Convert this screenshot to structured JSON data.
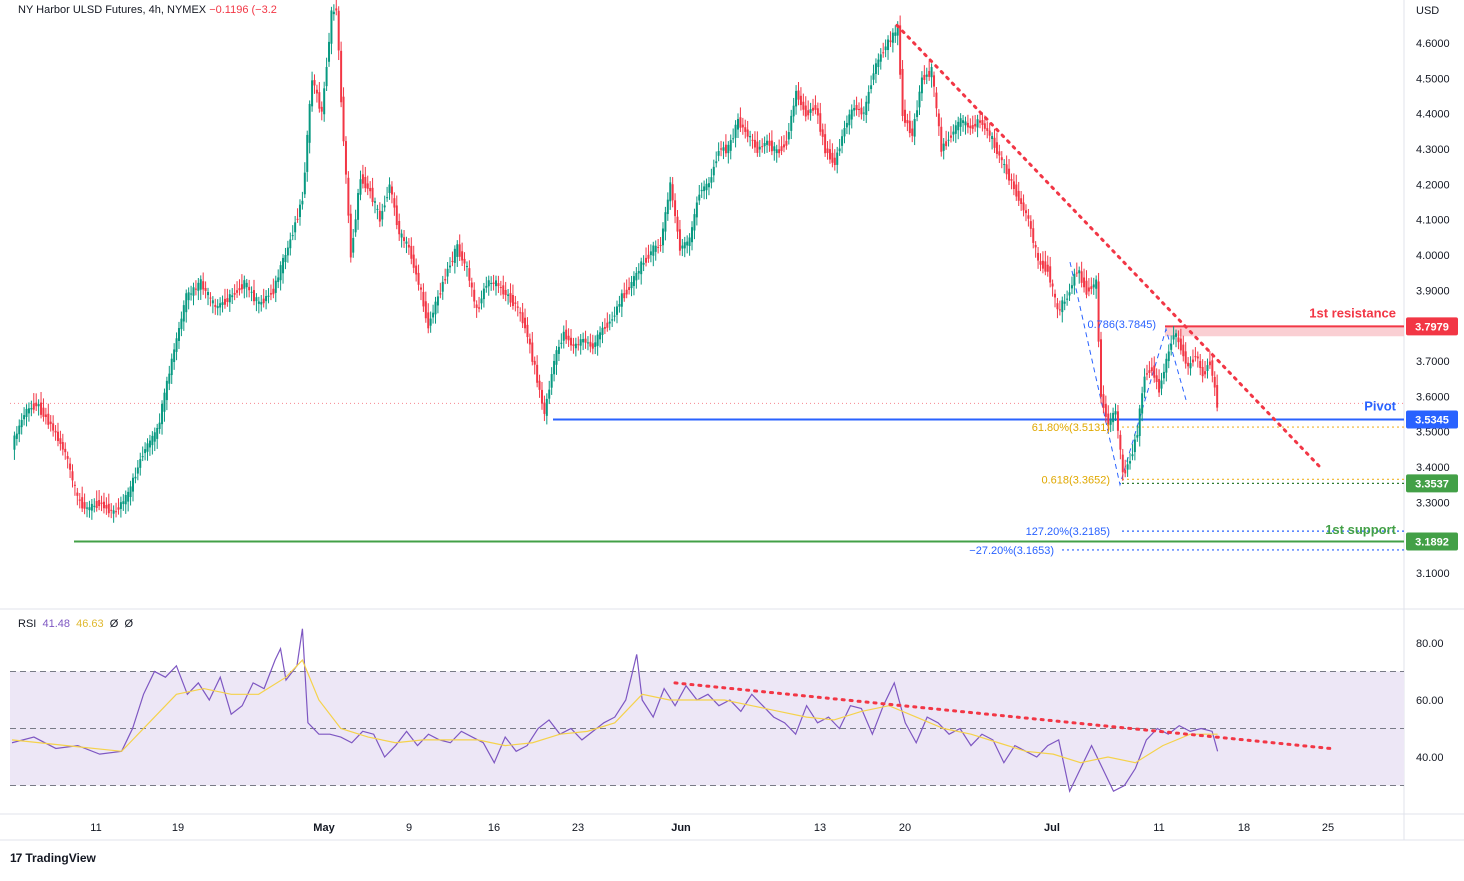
{
  "header": {
    "symbol": "NY Harbor ULSD Futures",
    "interval": "4h",
    "exchange": "NYMEX",
    "change": "−0.1196 (−3.2"
  },
  "rsi_header": {
    "label": "RSI",
    "value1": "41.48",
    "value2": "46.63",
    "z1": "Ø",
    "z2": "Ø"
  },
  "branding": {
    "logo_text": "TradingView",
    "logo_mark": "17"
  },
  "colors": {
    "up": "#089981",
    "down": "#f23645",
    "resistance": "#f23645",
    "pivot": "#2962ff",
    "support": "#43a047",
    "fib": "#f0b429",
    "fib_blue": "#2962ff",
    "rsi": "#7e57c2",
    "rsi_ma": "#f5d24b",
    "rsi_band": "#ede7f6",
    "trendline": "#f23645"
  },
  "chart_data": [
    {
      "type": "candlestick",
      "title": "NY Harbor ULSD Futures, 4h, NYMEX",
      "currency_label": "USD",
      "ylim": [
        3.04,
        4.72
      ],
      "y_ticks": [
        "4.6000",
        "4.5000",
        "4.4000",
        "4.3000",
        "4.2000",
        "4.1000",
        "4.0000",
        "3.9000",
        "3.7000",
        "3.6000",
        "3.5000",
        "3.4000",
        "3.3000",
        "3.1000"
      ],
      "x_ticks": [
        "11",
        "19",
        "May",
        "9",
        "16",
        "23",
        "Jun",
        "13",
        "20",
        "Jul",
        "11",
        "18",
        "25"
      ],
      "x_tick_bold": [
        "May",
        "Jun",
        "Jul"
      ],
      "close_series": [
        {
          "t": 0,
          "c": 3.46
        },
        {
          "t": 5,
          "c": 3.55
        },
        {
          "t": 10,
          "c": 3.58
        },
        {
          "t": 16,
          "c": 3.52
        },
        {
          "t": 22,
          "c": 3.44
        },
        {
          "t": 27,
          "c": 3.31
        },
        {
          "t": 31,
          "c": 3.28
        },
        {
          "t": 36,
          "c": 3.3
        },
        {
          "t": 42,
          "c": 3.27
        },
        {
          "t": 48,
          "c": 3.32
        },
        {
          "t": 54,
          "c": 3.44
        },
        {
          "t": 60,
          "c": 3.5
        },
        {
          "t": 66,
          "c": 3.7
        },
        {
          "t": 72,
          "c": 3.88
        },
        {
          "t": 78,
          "c": 3.92
        },
        {
          "t": 84,
          "c": 3.85
        },
        {
          "t": 90,
          "c": 3.88
        },
        {
          "t": 96,
          "c": 3.92
        },
        {
          "t": 102,
          "c": 3.86
        },
        {
          "t": 108,
          "c": 3.9
        },
        {
          "t": 114,
          "c": 4.02
        },
        {
          "t": 120,
          "c": 4.16
        },
        {
          "t": 124,
          "c": 4.5
        },
        {
          "t": 128,
          "c": 4.4
        },
        {
          "t": 132,
          "c": 4.68
        },
        {
          "t": 134,
          "c": 4.7
        },
        {
          "t": 136,
          "c": 4.44
        },
        {
          "t": 140,
          "c": 4.0
        },
        {
          "t": 144,
          "c": 4.22
        },
        {
          "t": 148,
          "c": 4.18
        },
        {
          "t": 152,
          "c": 4.1
        },
        {
          "t": 156,
          "c": 4.2
        },
        {
          "t": 160,
          "c": 4.06
        },
        {
          "t": 164,
          "c": 4.02
        },
        {
          "t": 168,
          "c": 3.92
        },
        {
          "t": 172,
          "c": 3.8
        },
        {
          "t": 176,
          "c": 3.88
        },
        {
          "t": 180,
          "c": 3.96
        },
        {
          "t": 184,
          "c": 4.02
        },
        {
          "t": 188,
          "c": 3.96
        },
        {
          "t": 192,
          "c": 3.84
        },
        {
          "t": 196,
          "c": 3.92
        },
        {
          "t": 200,
          "c": 3.92
        },
        {
          "t": 204,
          "c": 3.89
        },
        {
          "t": 208,
          "c": 3.86
        },
        {
          "t": 212,
          "c": 3.8
        },
        {
          "t": 216,
          "c": 3.68
        },
        {
          "t": 220,
          "c": 3.55
        },
        {
          "t": 224,
          "c": 3.7
        },
        {
          "t": 228,
          "c": 3.78
        },
        {
          "t": 232,
          "c": 3.74
        },
        {
          "t": 236,
          "c": 3.76
        },
        {
          "t": 240,
          "c": 3.74
        },
        {
          "t": 244,
          "c": 3.79
        },
        {
          "t": 248,
          "c": 3.82
        },
        {
          "t": 252,
          "c": 3.88
        },
        {
          "t": 256,
          "c": 3.92
        },
        {
          "t": 260,
          "c": 3.97
        },
        {
          "t": 264,
          "c": 4.01
        },
        {
          "t": 268,
          "c": 4.03
        },
        {
          "t": 272,
          "c": 4.2
        },
        {
          "t": 276,
          "c": 4.02
        },
        {
          "t": 280,
          "c": 4.04
        },
        {
          "t": 284,
          "c": 4.18
        },
        {
          "t": 288,
          "c": 4.2
        },
        {
          "t": 292,
          "c": 4.3
        },
        {
          "t": 296,
          "c": 4.3
        },
        {
          "t": 300,
          "c": 4.38
        },
        {
          "t": 304,
          "c": 4.34
        },
        {
          "t": 308,
          "c": 4.3
        },
        {
          "t": 312,
          "c": 4.32
        },
        {
          "t": 316,
          "c": 4.29
        },
        {
          "t": 320,
          "c": 4.32
        },
        {
          "t": 324,
          "c": 4.46
        },
        {
          "t": 328,
          "c": 4.4
        },
        {
          "t": 332,
          "c": 4.42
        },
        {
          "t": 336,
          "c": 4.3
        },
        {
          "t": 340,
          "c": 4.26
        },
        {
          "t": 344,
          "c": 4.36
        },
        {
          "t": 348,
          "c": 4.42
        },
        {
          "t": 352,
          "c": 4.4
        },
        {
          "t": 356,
          "c": 4.52
        },
        {
          "t": 360,
          "c": 4.58
        },
        {
          "t": 364,
          "c": 4.62
        },
        {
          "t": 366,
          "c": 4.64
        },
        {
          "t": 368,
          "c": 4.4
        },
        {
          "t": 372,
          "c": 4.34
        },
        {
          "t": 376,
          "c": 4.5
        },
        {
          "t": 380,
          "c": 4.52
        },
        {
          "t": 384,
          "c": 4.3
        },
        {
          "t": 388,
          "c": 4.34
        },
        {
          "t": 392,
          "c": 4.38
        },
        {
          "t": 396,
          "c": 4.36
        },
        {
          "t": 400,
          "c": 4.38
        },
        {
          "t": 404,
          "c": 4.34
        },
        {
          "t": 408,
          "c": 4.28
        },
        {
          "t": 412,
          "c": 4.22
        },
        {
          "t": 416,
          "c": 4.16
        },
        {
          "t": 420,
          "c": 4.1
        },
        {
          "t": 424,
          "c": 3.98
        },
        {
          "t": 428,
          "c": 3.96
        },
        {
          "t": 432,
          "c": 3.84
        },
        {
          "t": 436,
          "c": 3.88
        },
        {
          "t": 440,
          "c": 3.96
        },
        {
          "t": 444,
          "c": 3.9
        },
        {
          "t": 448,
          "c": 3.92
        },
        {
          "t": 450,
          "c": 3.6
        },
        {
          "t": 453,
          "c": 3.52
        },
        {
          "t": 456,
          "c": 3.56
        },
        {
          "t": 459,
          "c": 3.38
        },
        {
          "t": 462,
          "c": 3.42
        },
        {
          "t": 465,
          "c": 3.5
        },
        {
          "t": 468,
          "c": 3.66
        },
        {
          "t": 471,
          "c": 3.68
        },
        {
          "t": 474,
          "c": 3.62
        },
        {
          "t": 477,
          "c": 3.7
        },
        {
          "t": 480,
          "c": 3.78
        },
        {
          "t": 483,
          "c": 3.74
        },
        {
          "t": 486,
          "c": 3.68
        },
        {
          "t": 489,
          "c": 3.72
        },
        {
          "t": 492,
          "c": 3.66
        },
        {
          "t": 495,
          "c": 3.7
        },
        {
          "t": 498,
          "c": 3.58
        }
      ]
    },
    {
      "type": "line",
      "title": "RSI",
      "ylim": [
        18,
        90
      ],
      "y_ticks": [
        "80.00",
        "60.00",
        "40.00"
      ],
      "bands": [
        30,
        50,
        70
      ],
      "series": [
        {
          "name": "RSI",
          "values": [
            [
              0,
              45
            ],
            [
              8,
              47
            ],
            [
              16,
              43
            ],
            [
              24,
              44
            ],
            [
              32,
              41
            ],
            [
              40,
              42
            ],
            [
              44,
              50
            ],
            [
              48,
              62
            ],
            [
              52,
              70
            ],
            [
              56,
              68
            ],
            [
              60,
              72
            ],
            [
              64,
              62
            ],
            [
              68,
              66
            ],
            [
              72,
              60
            ],
            [
              76,
              68
            ],
            [
              80,
              55
            ],
            [
              84,
              58
            ],
            [
              88,
              66
            ],
            [
              92,
              64
            ],
            [
              96,
              74
            ],
            [
              98,
              78
            ],
            [
              100,
              67
            ],
            [
              104,
              72
            ],
            [
              106,
              85
            ],
            [
              108,
              52
            ],
            [
              112,
              48
            ],
            [
              116,
              48
            ],
            [
              120,
              47
            ],
            [
              124,
              45
            ],
            [
              128,
              49
            ],
            [
              132,
              48
            ],
            [
              136,
              40
            ],
            [
              140,
              44
            ],
            [
              144,
              49
            ],
            [
              148,
              44
            ],
            [
              152,
              48
            ],
            [
              156,
              46
            ],
            [
              160,
              45
            ],
            [
              164,
              49
            ],
            [
              168,
              47
            ],
            [
              172,
              45
            ],
            [
              176,
              38
            ],
            [
              180,
              47
            ],
            [
              184,
              42
            ],
            [
              188,
              44
            ],
            [
              192,
              50
            ],
            [
              196,
              53
            ],
            [
              200,
              48
            ],
            [
              204,
              50
            ],
            [
              208,
              46
            ],
            [
              212,
              49
            ],
            [
              216,
              52
            ],
            [
              220,
              54
            ],
            [
              224,
              60
            ],
            [
              228,
              76
            ],
            [
              230,
              60
            ],
            [
              234,
              54
            ],
            [
              238,
              64
            ],
            [
              242,
              58
            ],
            [
              246,
              65
            ],
            [
              250,
              60
            ],
            [
              254,
              62
            ],
            [
              258,
              58
            ],
            [
              262,
              60
            ],
            [
              266,
              56
            ],
            [
              270,
              62
            ],
            [
              274,
              58
            ],
            [
              278,
              54
            ],
            [
              282,
              52
            ],
            [
              286,
              48
            ],
            [
              290,
              58
            ],
            [
              294,
              52
            ],
            [
              298,
              54
            ],
            [
              302,
              50
            ],
            [
              306,
              58
            ],
            [
              310,
              57
            ],
            [
              314,
              48
            ],
            [
              318,
              58
            ],
            [
              322,
              66
            ],
            [
              326,
              52
            ],
            [
              330,
              45
            ],
            [
              334,
              54
            ],
            [
              338,
              52
            ],
            [
              342,
              48
            ],
            [
              346,
              50
            ],
            [
              350,
              44
            ],
            [
              354,
              48
            ],
            [
              358,
              46
            ],
            [
              362,
              38
            ],
            [
              366,
              44
            ],
            [
              370,
              42
            ],
            [
              374,
              40
            ],
            [
              378,
              44
            ],
            [
              382,
              46
            ],
            [
              386,
              28
            ],
            [
              390,
              36
            ],
            [
              394,
              44
            ],
            [
              398,
              36
            ],
            [
              402,
              28
            ],
            [
              406,
              30
            ],
            [
              410,
              36
            ],
            [
              414,
              46
            ],
            [
              418,
              50
            ],
            [
              422,
              48
            ],
            [
              426,
              51
            ],
            [
              430,
              49
            ],
            [
              434,
              50
            ],
            [
              438,
              49
            ],
            [
              440,
              42
            ]
          ]
        },
        {
          "name": "RSI MA",
          "values": [
            [
              0,
              46
            ],
            [
              20,
              44
            ],
            [
              40,
              42
            ],
            [
              50,
              52
            ],
            [
              60,
              62
            ],
            [
              70,
              64
            ],
            [
              80,
              62
            ],
            [
              90,
              62
            ],
            [
              100,
              68
            ],
            [
              106,
              74
            ],
            [
              112,
              60
            ],
            [
              120,
              50
            ],
            [
              130,
              47
            ],
            [
              140,
              45
            ],
            [
              150,
              46
            ],
            [
              160,
              46
            ],
            [
              170,
              46
            ],
            [
              180,
              44
            ],
            [
              190,
              45
            ],
            [
              200,
              48
            ],
            [
              210,
              49
            ],
            [
              220,
              52
            ],
            [
              230,
              62
            ],
            [
              240,
              60
            ],
            [
              250,
              60
            ],
            [
              260,
              60
            ],
            [
              270,
              58
            ],
            [
              280,
              56
            ],
            [
              290,
              54
            ],
            [
              300,
              53
            ],
            [
              310,
              56
            ],
            [
              320,
              58
            ],
            [
              330,
              54
            ],
            [
              340,
              50
            ],
            [
              350,
              48
            ],
            [
              360,
              45
            ],
            [
              370,
              42
            ],
            [
              380,
              41
            ],
            [
              390,
              38
            ],
            [
              400,
              40
            ],
            [
              410,
              38
            ],
            [
              420,
              44
            ],
            [
              430,
              48
            ],
            [
              440,
              48
            ]
          ]
        }
      ]
    }
  ],
  "annotations": {
    "resistance_label": "1st resistance",
    "resistance_value": "3.7979",
    "pivot_label": "Pivot",
    "pivot_value": "3.5345",
    "support_label": "1st support",
    "support_value": "3.1892",
    "level_3537": "3.3537",
    "fib_786": "0.786(3.7845)",
    "fib_618_pct": "61.80%(3.5131)",
    "fib_618": "0.618(3.3652)",
    "fib_1272": "127.20%(3.2185)",
    "fib_n272": "−27.20%(3.1653)"
  }
}
